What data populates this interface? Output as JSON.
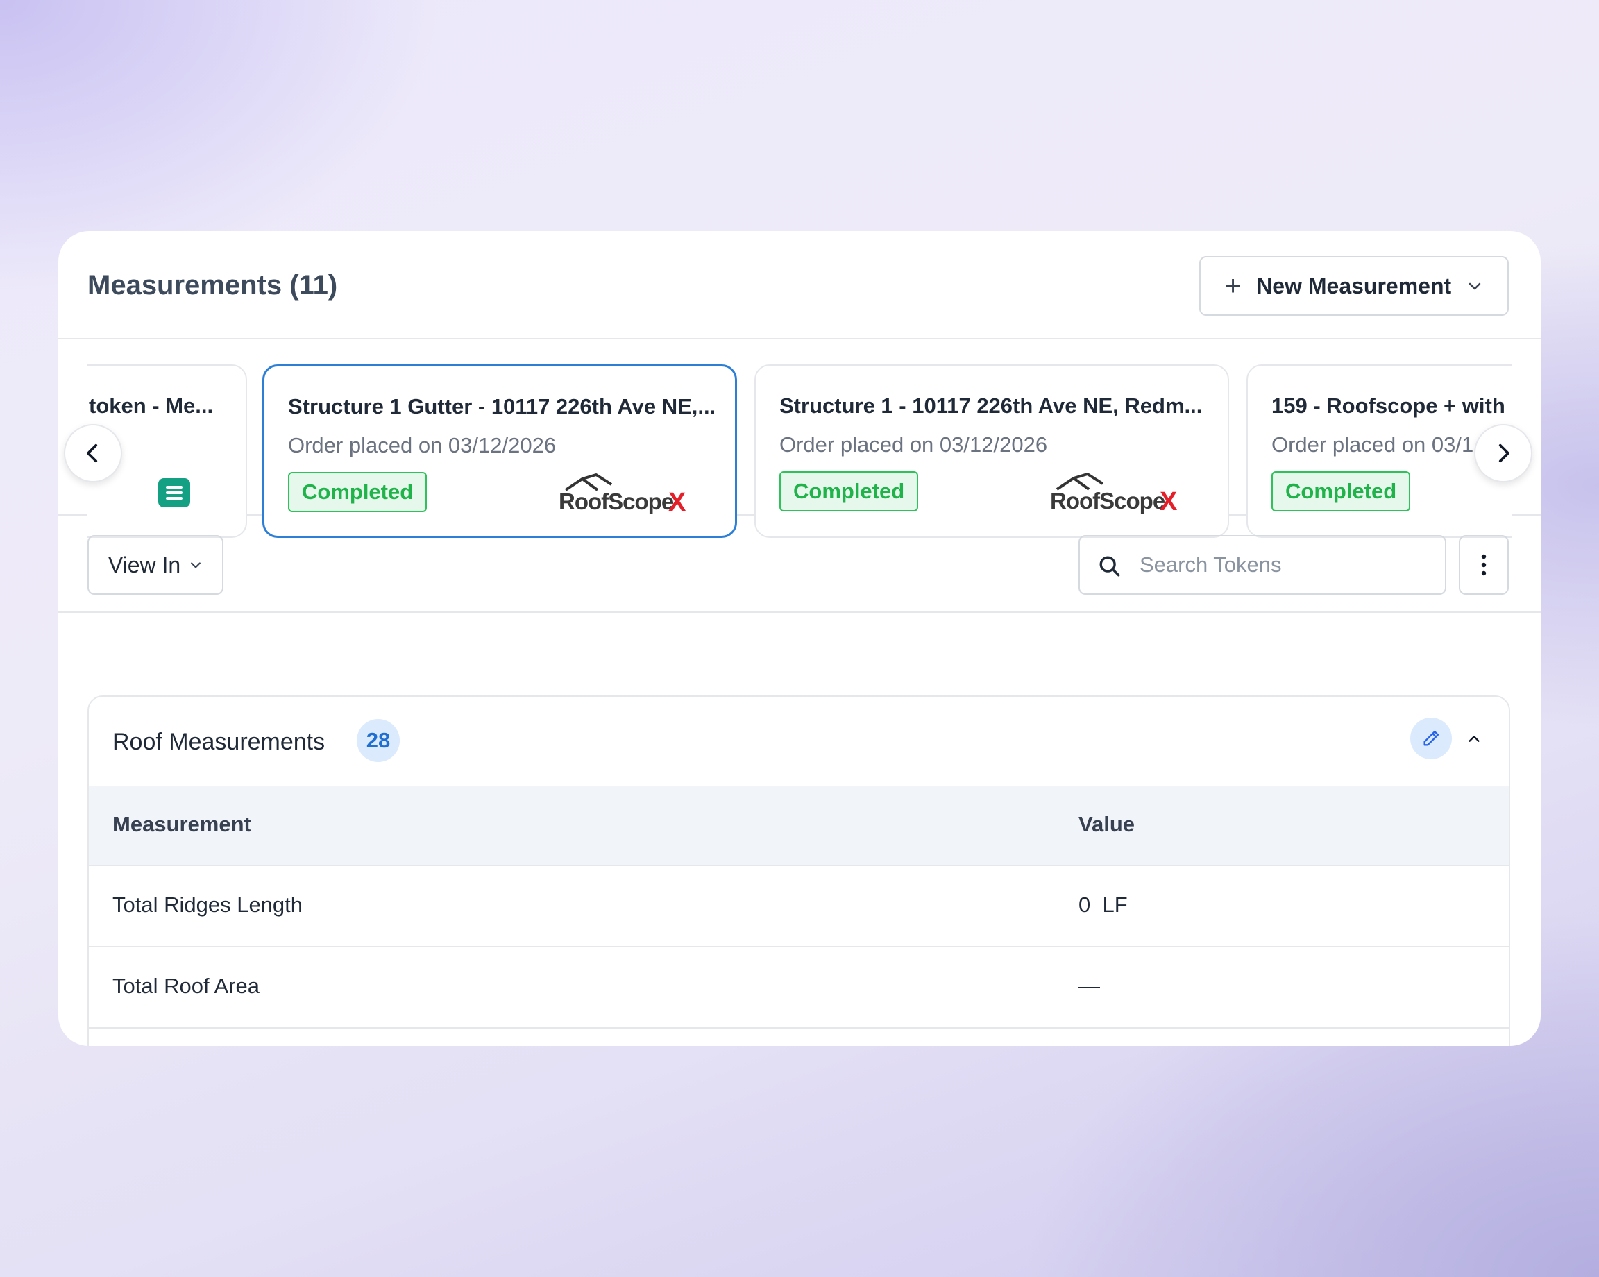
{
  "header": {
    "title": "Measurements (11)",
    "new_button_label": "New Measurement"
  },
  "carousel": {
    "cards": [
      {
        "title": "token - Me...",
        "subtitle": "",
        "status": "",
        "icon": "document-list-icon"
      },
      {
        "title": "Structure 1 Gutter - 10117 226th Ave NE,...",
        "subtitle": "Order placed on 03/12/2026",
        "status": "Completed",
        "logo": "RoofScopeX",
        "selected": true
      },
      {
        "title": "Structure 1 - 10117 226th Ave NE, Redm...",
        "subtitle": "Order placed on 03/12/2026",
        "status": "Completed",
        "logo": "RoofScopeX",
        "selected": false
      },
      {
        "title": "159 - Roofscope + with",
        "subtitle": "Order placed on 03/1",
        "status": "Completed",
        "selected": false
      }
    ]
  },
  "toolbar": {
    "view_label": "View In",
    "search_placeholder": "Search Tokens"
  },
  "section": {
    "title": "Roof Measurements",
    "count": "28",
    "columns": [
      "Measurement",
      "Value"
    ],
    "rows": [
      {
        "measurement": "Total Ridges Length",
        "value": "0  LF"
      },
      {
        "measurement": "Total Roof Area",
        "value": "—"
      }
    ]
  },
  "colors": {
    "accent": "#2d7fd6",
    "status_green": "#1fb34a",
    "logo_red": "#e3202a"
  }
}
